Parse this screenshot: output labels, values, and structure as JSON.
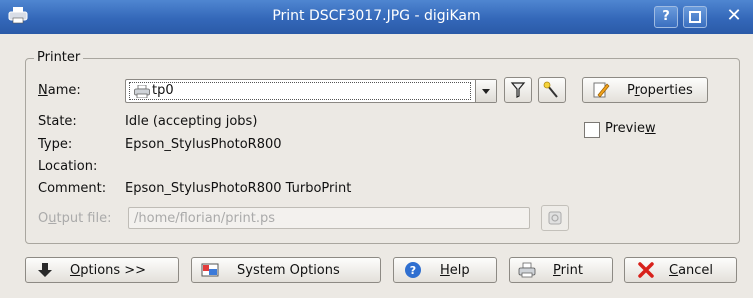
{
  "window": {
    "title": "Print DSCF3017.JPG - digiKam",
    "help_glyph": "?",
    "close_glyph": "✕"
  },
  "printer_group": {
    "title": "Printer",
    "name_label": "Name:",
    "name_value": "tp0",
    "state_label": "State:",
    "state_value": "Idle (accepting jobs)",
    "type_label": "Type:",
    "type_value": "Epson_StylusPhotoR800",
    "location_label": "Location:",
    "location_value": "",
    "comment_label": "Comment:",
    "comment_value": "Epson_StylusPhotoR800 TurboPrint",
    "properties_label": "Properties",
    "preview_label": "Preview",
    "preview_checked": false,
    "output_file_label": "Output file:",
    "output_file_value": "/home/florian/print.ps"
  },
  "buttons": {
    "options": "Options >>",
    "system_options": "System Options",
    "help": "Help",
    "print": "Print",
    "cancel": "Cancel"
  },
  "colors": {
    "titlebar": "#3468b9",
    "window_bg": "#ece9e4",
    "help_icon": "#2f6fd0",
    "cancel_icon": "#d8211b"
  }
}
